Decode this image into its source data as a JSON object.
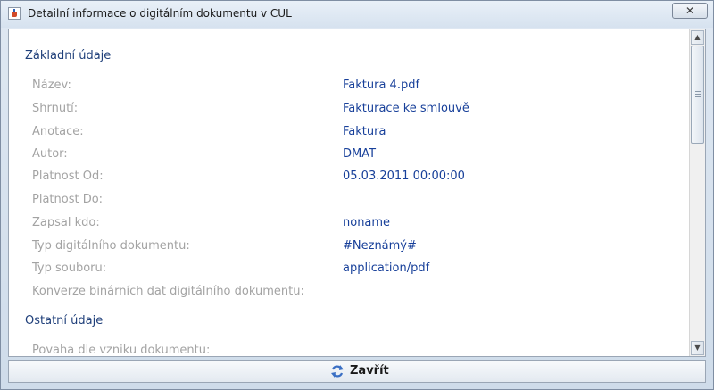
{
  "window": {
    "title": "Detailní informace o digitálním dokumentu v CUL",
    "close_glyph": "✕"
  },
  "sections": [
    {
      "title": "Základní údaje",
      "rows": [
        {
          "label": "Název:",
          "value": "Faktura 4.pdf"
        },
        {
          "label": "Shrnutí:",
          "value": "Fakturace ke smlouvě"
        },
        {
          "label": "Anotace:",
          "value": "Faktura"
        },
        {
          "label": "Autor:",
          "value": "DMAT"
        },
        {
          "label": "Platnost Od:",
          "value": "05.03.2011 00:00:00"
        },
        {
          "label": "Platnost Do:",
          "value": ""
        },
        {
          "label": "Zapsal kdo:",
          "value": "noname"
        },
        {
          "label": "Typ digitálního dokumentu:",
          "value": "#Neznámý#"
        },
        {
          "label": "Typ souboru:",
          "value": "application/pdf"
        },
        {
          "label": "Konverze binárních dat digitálního dokumentu:",
          "value": ""
        }
      ]
    },
    {
      "title": "Ostatní údaje",
      "rows": [
        {
          "label": "Povaha dle vzniku dokumentu:",
          "value": ""
        }
      ]
    }
  ],
  "scrollbar": {
    "up_glyph": "▲",
    "down_glyph": "▼"
  },
  "footer": {
    "close_label": "Zavřít",
    "icon": "refresh-arrows-icon"
  },
  "colors": {
    "section_title": "#1f3f7a",
    "label": "#a3a3a3",
    "value": "#18409a"
  }
}
